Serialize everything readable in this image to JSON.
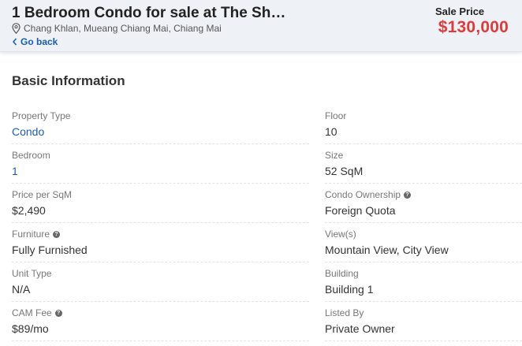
{
  "header": {
    "title": "1 Bedroom Condo for sale at The Sh…",
    "location": "Chang Khlan, Mueang Chiang Mai, Chiang Mai",
    "back_label": "Go back",
    "price_label": "Sale Price",
    "price_value": "$130,000"
  },
  "section": {
    "title": "Basic Information"
  },
  "rows": [
    {
      "left": {
        "label": "Property Type",
        "value": "Condo"
      },
      "right": {
        "label": "Floor",
        "value": "10"
      }
    },
    {
      "left": {
        "label": "Bedroom",
        "value": "1"
      },
      "right": {
        "label": "Size",
        "value": "52 SqM"
      }
    },
    {
      "left": {
        "label": "Price per SqM",
        "value": "$2,490"
      },
      "right": {
        "label": "Condo Ownership",
        "value": "Foreign Quota"
      }
    },
    {
      "left": {
        "label": "Furniture",
        "value": "Fully Furnished"
      },
      "right": {
        "label": "View(s)",
        "value": "Mountain View, City View"
      }
    },
    {
      "left": {
        "label": "Unit Type",
        "value": "N/A"
      },
      "right": {
        "label": "Building",
        "value": "Building 1"
      }
    },
    {
      "left": {
        "label": "CAM Fee",
        "value": "$89/mo"
      },
      "right": {
        "label": "Listed By",
        "value": "Private Owner"
      }
    }
  ],
  "icons": {
    "location": "map-pin-icon",
    "back": "chevron-left-icon",
    "help": "question-circle-icon",
    "help_glyph": "?"
  },
  "colors": {
    "price": "#e03b3b",
    "link": "#1a5db0",
    "header_bg": "#eef2f7"
  }
}
